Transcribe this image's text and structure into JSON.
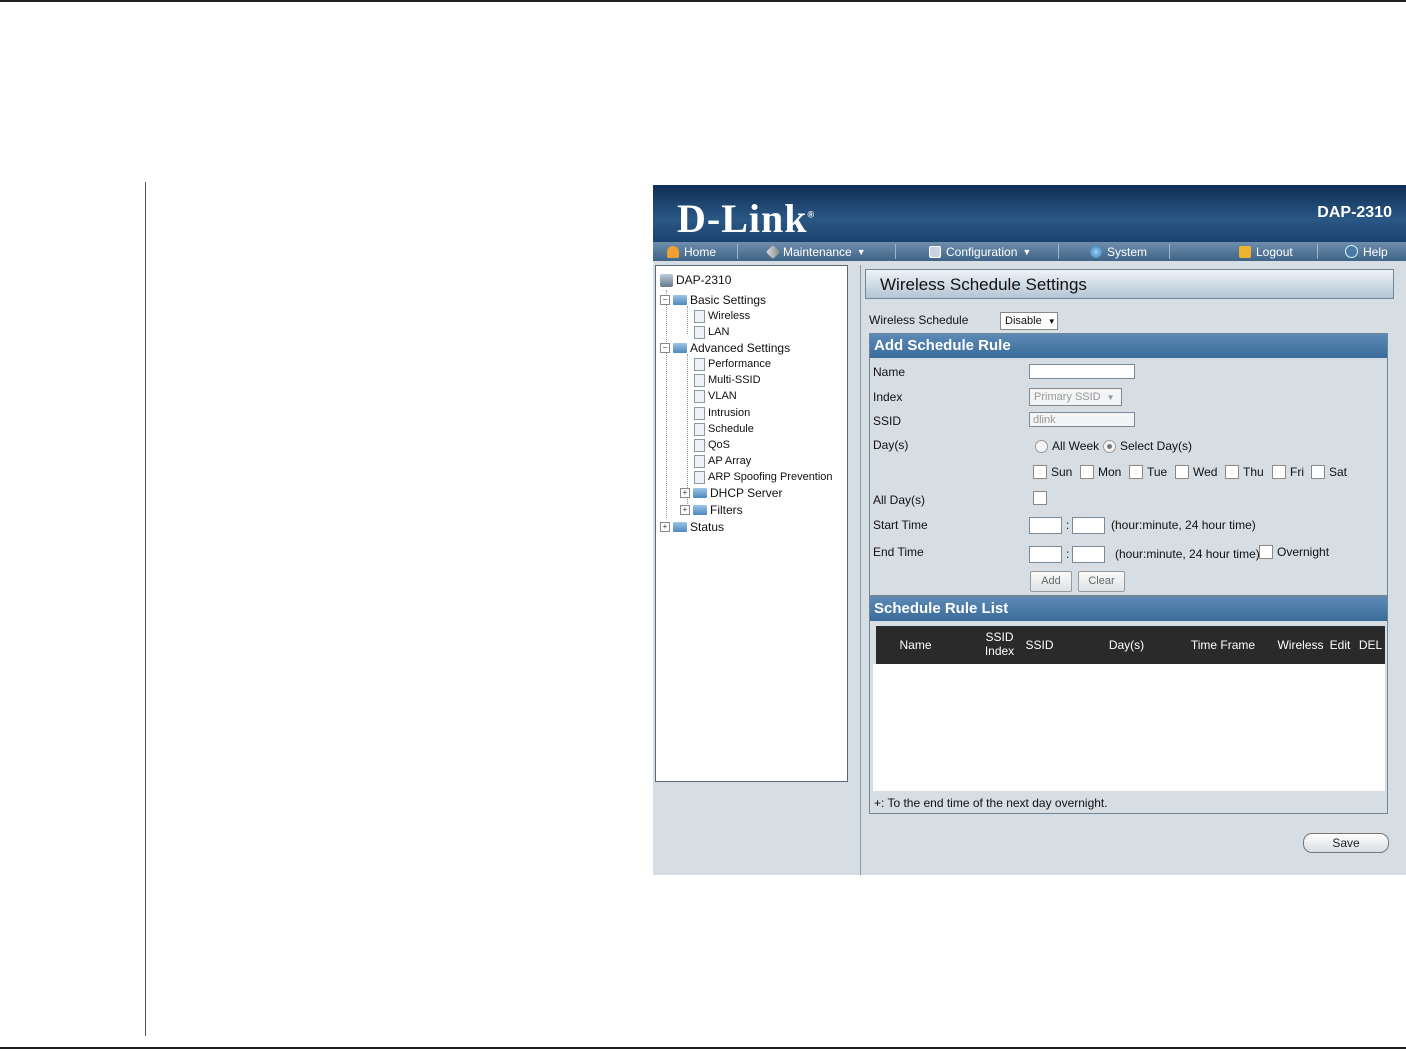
{
  "header": {
    "logo": "D-Link",
    "logo_mark": "®",
    "model": "DAP-2310"
  },
  "nav": {
    "home": "Home",
    "maintenance": "Maintenance",
    "configuration": "Configuration",
    "system": "System",
    "logout": "Logout",
    "help": "Help",
    "caret": "▼"
  },
  "tree": {
    "root": "DAP-2310",
    "basic": "Basic Settings",
    "wireless": "Wireless",
    "lan": "LAN",
    "advanced": "Advanced Settings",
    "performance": "Performance",
    "multi_ssid": "Multi-SSID",
    "vlan": "VLAN",
    "intrusion": "Intrusion",
    "schedule": "Schedule",
    "qos": "QoS",
    "ap_array": "AP Array",
    "arp": "ARP Spoofing Prevention",
    "dhcp": "DHCP Server",
    "filters": "Filters",
    "status": "Status",
    "minus": "−",
    "plus": "+"
  },
  "page": {
    "title": "Wireless Schedule Settings",
    "wireless_schedule_label": "Wireless Schedule",
    "wireless_schedule_value": "Disable"
  },
  "add_rule": {
    "heading": "Add Schedule Rule",
    "name_label": "Name",
    "name_value": "",
    "index_label": "Index",
    "index_value": "Primary SSID",
    "ssid_label": "SSID",
    "ssid_value": "dlink",
    "days_label": "Day(s)",
    "all_week": "All Week",
    "select_days": "Select Day(s)",
    "days": [
      "Sun",
      "Mon",
      "Tue",
      "Wed",
      "Thu",
      "Fri",
      "Sat"
    ],
    "all_days_label": "All Day(s)",
    "start_label": "Start Time",
    "end_label": "End Time",
    "colon": ":",
    "time_hint": "(hour:minute, 24 hour time)",
    "overnight": "Overnight",
    "add": "Add",
    "clear": "Clear"
  },
  "rule_list": {
    "heading": "Schedule Rule List",
    "columns": [
      "Name",
      "SSID Index",
      "SSID",
      "Day(s)",
      "Time Frame",
      "Wireless",
      "Edit",
      "DEL"
    ],
    "note": "+: To the end time of the next day overnight."
  },
  "footer": {
    "save": "Save"
  }
}
